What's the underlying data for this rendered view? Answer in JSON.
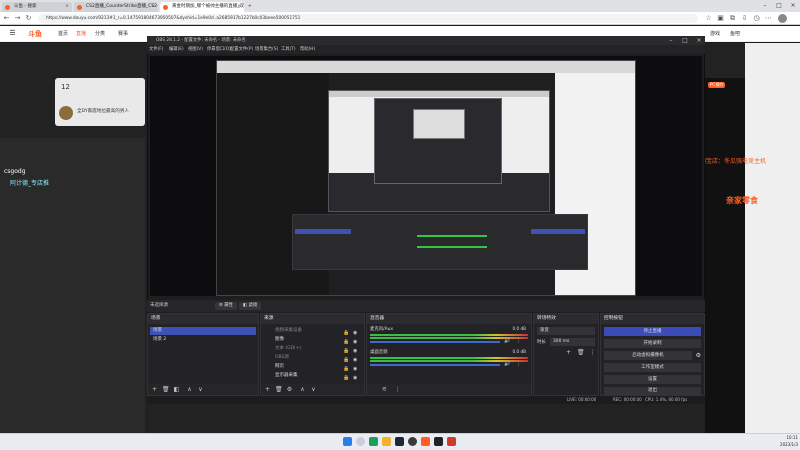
{
  "browser": {
    "tabs": [
      {
        "label": "斗鱼 - 搜索",
        "active": false
      },
      {
        "label": "CS2直播_CounterStrike直播_CS2",
        "active": false
      },
      {
        "label": "黄金时期加_哪个被帅主播的直播_双",
        "active": true
      }
    ],
    "url": "https://www.douyu.com/9213#1_r=0.147591804673950507&dyshid=1e9e0d..a2685917b1227b0c03beee500051751"
  },
  "site": {
    "logo": "斗鱼",
    "nav": [
      {
        "label": "首页",
        "active": false
      },
      {
        "label": "直播",
        "active": true
      },
      {
        "label": "分类",
        "active": false
      },
      {
        "label": "赛事",
        "active": false
      },
      {
        "label": "游戏",
        "active": false
      },
      {
        "label": "鱼吧",
        "active": false
      }
    ]
  },
  "page": {
    "stream_title": "全DY家庭地位最高的男人",
    "streamer_tag": "csgodg",
    "streamer_sub": "阿计德_专店推",
    "right_sponsor": "亲家零食",
    "right_store": "淘宝店：冬瓜强电竞主机",
    "pcbox": "PC预约",
    "count": "12"
  },
  "obs": {
    "title": "OBS 28.1.2 - 配置文件: 未命名 - 场景: 未命名",
    "menu": [
      "文件(F)",
      "编辑(E)",
      "视图(V)",
      "停靠窗口(D)",
      "配置文件(P)",
      "场景集合(S)",
      "工具(T)",
      "帮助(H)"
    ],
    "source_toolbar": {
      "none_selected": "未选择源",
      "properties": "属性",
      "filters": "滤镜"
    },
    "scenes": {
      "title": "场景",
      "items": [
        {
          "label": "场景",
          "selected": true
        },
        {
          "label": "场景 2",
          "selected": false
        }
      ]
    },
    "sources": {
      "title": "来源",
      "items": [
        "视频采集设备",
        "图像",
        "文本 (GDI+)",
        "OBS源",
        "网页",
        "显示器采集"
      ]
    },
    "mixer": {
      "title": "混音器",
      "channels": [
        {
          "name": "麦克风/Aux",
          "db": "0.0 dB"
        },
        {
          "name": "桌面音频",
          "db": "0.0 dB"
        }
      ]
    },
    "transitions": {
      "title": "转场特效",
      "type": "渐变",
      "duration_label": "时长",
      "duration": "300 ms"
    },
    "controls": {
      "title": "控制按钮",
      "buttons": [
        "停止直播",
        "开始录制",
        "启动虚拟摄像机",
        "工作室模式",
        "设置",
        "退出"
      ]
    },
    "status": {
      "live": "LIVE: 00:00:00",
      "rec": "REC: 00:00:00",
      "cpu": "CPU: 1.4%, 60.00 fps"
    }
  },
  "taskbar": {
    "time": "10:11",
    "date": "2023/1/3"
  },
  "colors": {
    "douyu_orange": "#ff5d23",
    "obs_selected": "#3f51b5",
    "meter_green": "#3bbd42"
  }
}
